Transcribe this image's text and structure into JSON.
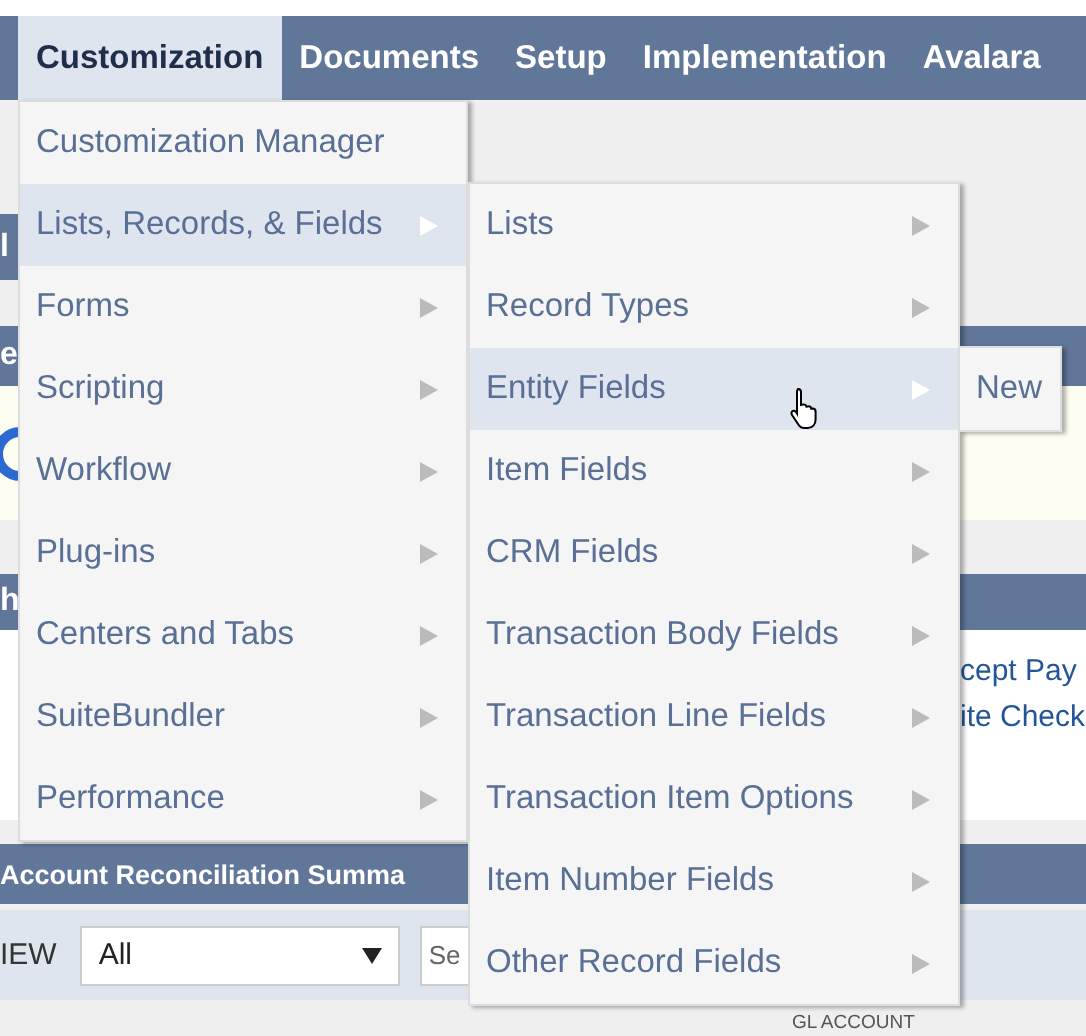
{
  "nav": {
    "tabs": [
      {
        "label": "Customization",
        "selected": true
      },
      {
        "label": "Documents",
        "selected": false
      },
      {
        "label": "Setup",
        "selected": false
      },
      {
        "label": "Implementation",
        "selected": false
      },
      {
        "label": "Avalara",
        "selected": false
      }
    ]
  },
  "background": {
    "portlet_1_title": "l",
    "portlet_2_title": "e",
    "portlet_3_title": "h",
    "portlet_3_links": [
      "cept Pay",
      "ite Check"
    ],
    "reconciliation": {
      "title": "Account Reconciliation Summa",
      "view_label": "IEW",
      "view_select": {
        "value": "All"
      },
      "search": {
        "placeholder": "Se"
      },
      "column_1": "GL ACCOUNT"
    }
  },
  "menus": [
    {
      "items": [
        {
          "label": "Customization Manager",
          "selected": false,
          "has_submenu": false
        },
        {
          "label": "Lists, Records, & Fields",
          "selected": true,
          "has_submenu": true
        },
        {
          "label": "Forms",
          "selected": false,
          "has_submenu": true
        },
        {
          "label": "Scripting",
          "selected": false,
          "has_submenu": true
        },
        {
          "label": "Workflow",
          "selected": false,
          "has_submenu": true
        },
        {
          "label": "Plug-ins",
          "selected": false,
          "has_submenu": true
        },
        {
          "label": "Centers and Tabs",
          "selected": false,
          "has_submenu": true
        },
        {
          "label": "SuiteBundler",
          "selected": false,
          "has_submenu": true
        },
        {
          "label": "Performance",
          "selected": false,
          "has_submenu": true
        }
      ]
    },
    {
      "items": [
        {
          "label": "Lists",
          "selected": false,
          "has_submenu": true
        },
        {
          "label": "Record Types",
          "selected": false,
          "has_submenu": true
        },
        {
          "label": "Entity Fields",
          "selected": true,
          "has_submenu": true
        },
        {
          "label": "Item Fields",
          "selected": false,
          "has_submenu": true
        },
        {
          "label": "CRM Fields",
          "selected": false,
          "has_submenu": true
        },
        {
          "label": "Transaction Body Fields",
          "selected": false,
          "has_submenu": true
        },
        {
          "label": "Transaction Line Fields",
          "selected": false,
          "has_submenu": true
        },
        {
          "label": "Transaction Item Options",
          "selected": false,
          "has_submenu": true
        },
        {
          "label": "Item Number Fields",
          "selected": false,
          "has_submenu": true
        },
        {
          "label": "Other Record Fields",
          "selected": false,
          "has_submenu": true
        }
      ]
    },
    {
      "items": [
        {
          "label": "New",
          "selected": false,
          "has_submenu": false
        }
      ]
    }
  ]
}
